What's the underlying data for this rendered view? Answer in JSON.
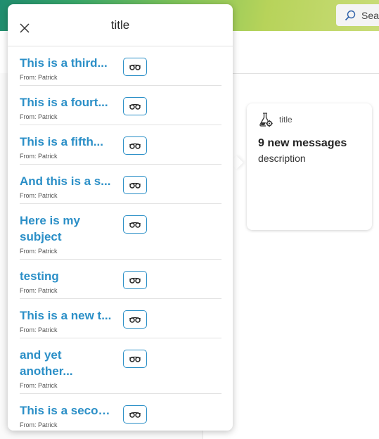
{
  "search": {
    "label": "Sea"
  },
  "popup": {
    "title": "title",
    "items": [
      {
        "subject": "This is a third...",
        "from": "From: Patrick"
      },
      {
        "subject": "This is a fourt...",
        "from": "From: Patrick"
      },
      {
        "subject": "This is a fifth...",
        "from": "From: Patrick"
      },
      {
        "subject": "And this is a s...",
        "from": "From: Patrick"
      },
      {
        "subject": "Here is my subject",
        "from": "From: Patrick"
      },
      {
        "subject": "testing",
        "from": "From: Patrick"
      },
      {
        "subject": "This is a new t...",
        "from": "From: Patrick"
      },
      {
        "subject": "and yet another...",
        "from": "From: Patrick"
      },
      {
        "subject": "This is a secon...",
        "from": "From: Patrick"
      }
    ]
  },
  "card": {
    "title": "title",
    "count_text": "9 new messages",
    "description": "description"
  },
  "colors": {
    "accent": "#2b8fc7",
    "banner_green": "#3aa86a"
  },
  "icons": {
    "close": "close-icon",
    "read": "glasses-icon",
    "card": "flask-gear-icon",
    "search": "search-icon"
  }
}
